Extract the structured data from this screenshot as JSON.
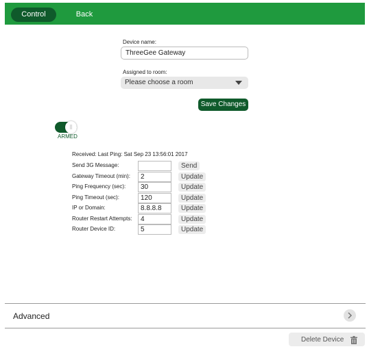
{
  "nav": {
    "control_label": "Control",
    "back_label": "Back"
  },
  "form": {
    "device_name_label": "Device name:",
    "device_name_value": "ThreeGee Gateway",
    "room_label": "Assigned to room:",
    "room_selected": "Please choose a room",
    "save_label": "Save Changes"
  },
  "toggle": {
    "state_label": "ARMED",
    "on": true
  },
  "status": {
    "received_text": "Received: Last Ping: Sat Sep 23 13:56:01 2017"
  },
  "settings": [
    {
      "label": "Send 3G Message:",
      "value": "",
      "button": "Send"
    },
    {
      "label": "Gateway Timeout (min):",
      "value": "2",
      "button": "Update"
    },
    {
      "label": "Ping Frequency (sec):",
      "value": "30",
      "button": "Update"
    },
    {
      "label": "Ping Timeout (sec):",
      "value": "120",
      "button": "Update"
    },
    {
      "label": "IP or Domain:",
      "value": "8.8.8.8",
      "button": "Update"
    },
    {
      "label": "Router Restart Attempts:",
      "value": "4",
      "button": "Update"
    },
    {
      "label": "Router Device ID:",
      "value": "5",
      "button": "Update"
    }
  ],
  "advanced": {
    "label": "Advanced"
  },
  "footer": {
    "delete_label": "Delete Device"
  },
  "colors": {
    "brand_green": "#1f9a3e",
    "dark_green": "#0f5a2b"
  },
  "icons": {
    "advanced_chevron": "chevron-right-icon",
    "delete": "trash-icon",
    "room_dropdown": "caret-down-icon"
  }
}
